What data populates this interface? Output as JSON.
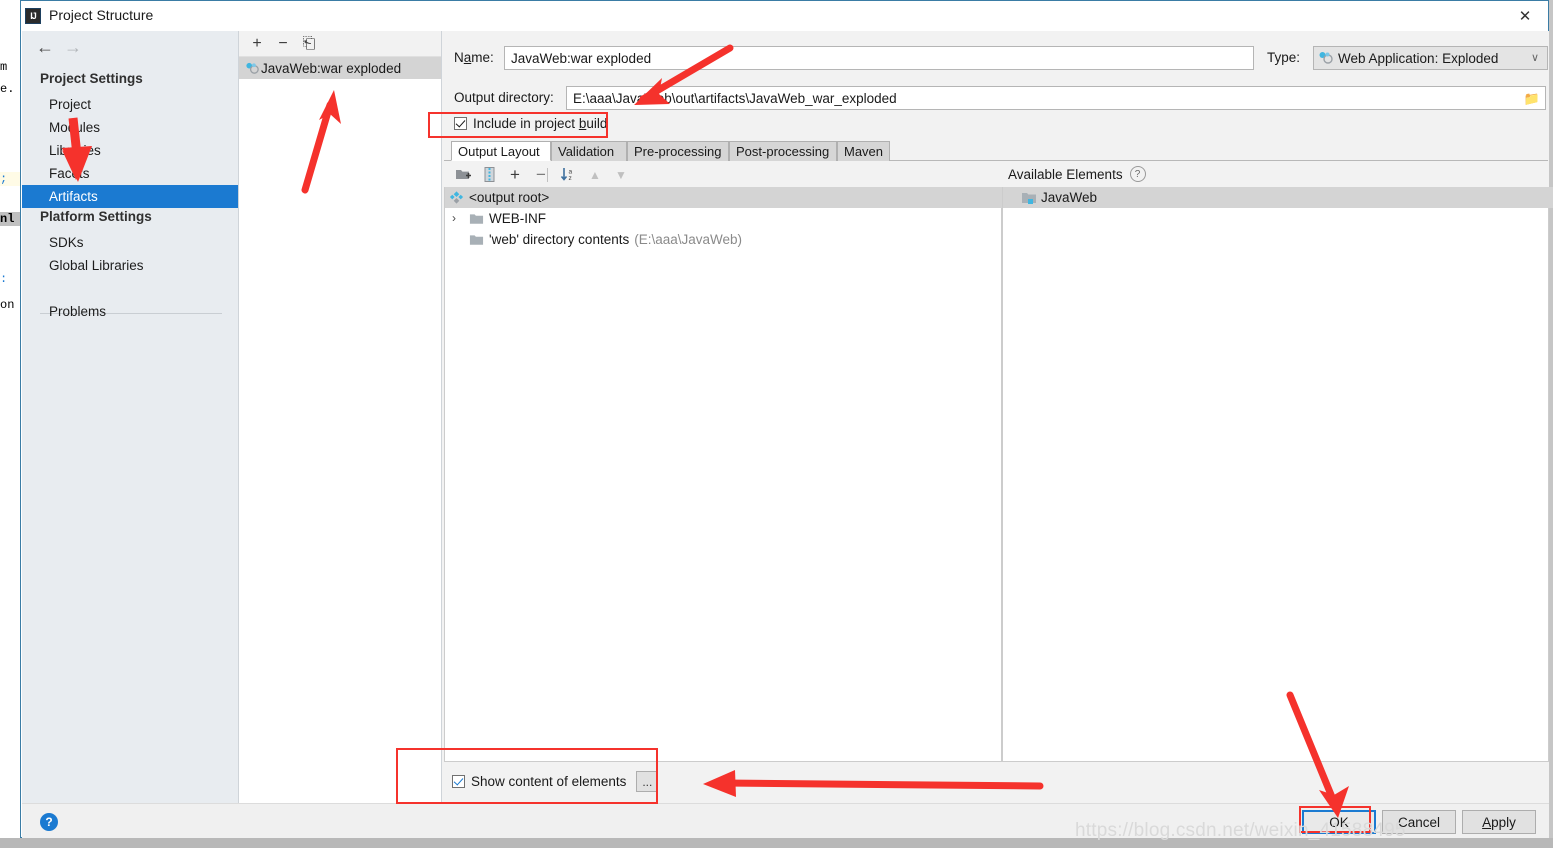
{
  "window": {
    "title": "Project Structure",
    "app_icon": "intellij-idea-icon",
    "close_label": "✕"
  },
  "nav": {
    "back_icon": "←",
    "forward_icon": "→"
  },
  "sidebar": {
    "groups": [
      {
        "label": "Project Settings"
      },
      {
        "label": "Platform Settings"
      }
    ],
    "items": [
      {
        "label": "Project",
        "selected": false
      },
      {
        "label": "Modules",
        "selected": false
      },
      {
        "label": "Libraries",
        "selected": false
      },
      {
        "label": "Facets",
        "selected": false
      },
      {
        "label": "Artifacts",
        "selected": true
      },
      {
        "label": "SDKs",
        "selected": false
      },
      {
        "label": "Global Libraries",
        "selected": false
      },
      {
        "label": "Problems",
        "selected": false
      }
    ]
  },
  "artifacts_panel": {
    "toolbar": {
      "add_label": "+",
      "remove_label": "−",
      "copy_label": "⎗"
    },
    "items": [
      {
        "label": "JavaWeb:war exploded",
        "icon": "artifact-icon",
        "selected": true
      }
    ]
  },
  "main": {
    "name_label": "Name:",
    "name_value": "JavaWeb:war exploded",
    "type_label": "Type:",
    "type_value": "Web Application: Exploded",
    "type_caret": "∨",
    "outdir_label": "Output directory:",
    "outdir_value": "E:\\aaa\\JavaWeb\\out\\artifacts\\JavaWeb_war_exploded",
    "outdir_browse_icon": "folder-icon",
    "include_in_build_label_1": "Include in project ",
    "include_in_build_label_2": "b",
    "include_in_build_label_3": "uild",
    "include_in_build_checked": true,
    "tabs": [
      {
        "label": "Output Layout",
        "active": true
      },
      {
        "label": "Validation",
        "active": false
      },
      {
        "label": "Pre-processing",
        "active": false
      },
      {
        "label": "Post-processing",
        "active": false
      },
      {
        "label": "Maven",
        "active": false
      }
    ],
    "tree_toolbar": [
      {
        "name": "add-directory-icon"
      },
      {
        "name": "add-archive-icon"
      },
      {
        "name": "add-plus-icon"
      },
      {
        "name": "remove-minus-icon"
      },
      {
        "name": "sort-alpha-icon"
      },
      {
        "name": "move-up-icon"
      },
      {
        "name": "move-down-icon"
      }
    ],
    "tree": [
      {
        "label": "<output root>",
        "detail": "",
        "icon": "output-root-icon",
        "indent": 0,
        "selected": true,
        "twisty": ""
      },
      {
        "label": "WEB-INF",
        "detail": "",
        "icon": "folder-icon",
        "indent": 1,
        "selected": false,
        "twisty": "›"
      },
      {
        "label": "'web' directory contents",
        "detail": "(E:\\aaa\\JavaWeb)",
        "icon": "folder-icon",
        "indent": 1,
        "selected": false,
        "twisty": ""
      }
    ],
    "available_elements_label": "Available Elements",
    "available_help_icon": "?",
    "available_items": [
      {
        "label": "JavaWeb",
        "icon": "module-folder-icon",
        "selected": true
      }
    ],
    "show_content_label": "Show content of elements",
    "show_content_checked": true,
    "dots_button_label": "..."
  },
  "footer": {
    "help_label": "?",
    "buttons": [
      {
        "label": "OK",
        "default": true
      },
      {
        "label": "Cancel",
        "default": false
      },
      {
        "label": "Apply",
        "default": false
      }
    ]
  },
  "annotations": {
    "watermark": "https://blog.csdn.net/weixin_41588495",
    "highlight_color": "#f5322c",
    "arrows": [
      {
        "name": "arrow-to-artifacts-sidebar-item"
      },
      {
        "name": "arrow-to-artifact-list-item"
      },
      {
        "name": "arrow-to-output-directory"
      },
      {
        "name": "arrow-to-show-content-checkbox"
      },
      {
        "name": "arrow-to-ok-button"
      }
    ],
    "boxes": [
      {
        "name": "box-include-in-project-build"
      },
      {
        "name": "box-show-content-of-elements"
      },
      {
        "name": "box-ok-button"
      }
    ]
  },
  "background_fragments": [
    {
      "text": "m"
    },
    {
      "text": "e."
    },
    {
      "text": ";"
    },
    {
      "text": "nl"
    },
    {
      "text": ":"
    },
    {
      "text": "on"
    }
  ]
}
